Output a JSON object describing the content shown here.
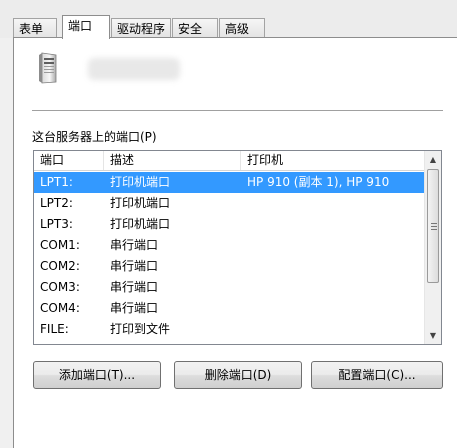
{
  "tabs": [
    {
      "label": "表单"
    },
    {
      "label": "端口",
      "active": true
    },
    {
      "label": "驱动程序"
    },
    {
      "label": "安全"
    },
    {
      "label": "高级"
    }
  ],
  "server_ports_label": "这台服务器上的端口(P)",
  "columns": [
    "端口",
    "描述",
    "打印机"
  ],
  "ports": [
    {
      "port": "LPT1:",
      "description": "打印机端口",
      "printer": "HP 910 (副本 1), HP 910",
      "selected": true
    },
    {
      "port": "LPT2:",
      "description": "打印机端口",
      "printer": ""
    },
    {
      "port": "LPT3:",
      "description": "打印机端口",
      "printer": ""
    },
    {
      "port": "COM1:",
      "description": "串行端口",
      "printer": ""
    },
    {
      "port": "COM2:",
      "description": "串行端口",
      "printer": ""
    },
    {
      "port": "COM3:",
      "description": "串行端口",
      "printer": ""
    },
    {
      "port": "COM4:",
      "description": "串行端口",
      "printer": ""
    },
    {
      "port": "FILE:",
      "description": "打印到文件",
      "printer": ""
    }
  ],
  "buttons": {
    "add_port": "添加端口(T)...",
    "delete_port": "删除端口(D)",
    "configure_port": "配置端口(C)..."
  },
  "colors": {
    "selection": "#3399ff",
    "panel": "#ffffff",
    "background": "#f0f0f0"
  },
  "icons": {
    "printer_server": "server-tower-icon",
    "scroll_up": "scroll-up-arrow-icon",
    "scroll_down": "scroll-down-arrow-icon"
  }
}
